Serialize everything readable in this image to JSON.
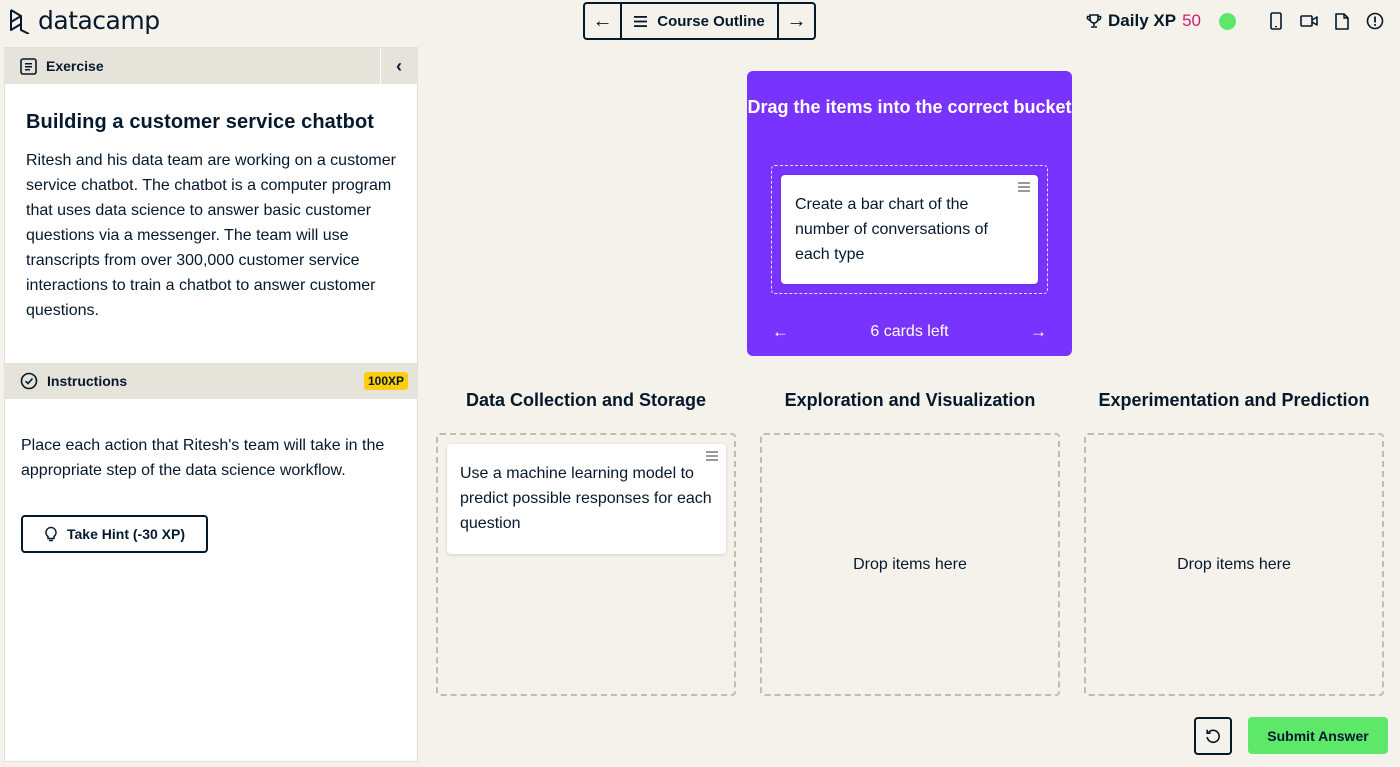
{
  "header": {
    "brand": "datacamp",
    "nav": {
      "prev_icon": "arrow-left-icon",
      "outline_label": "Course Outline",
      "next_icon": "arrow-right-icon"
    },
    "daily_xp_label": "Daily XP",
    "daily_xp_value": "50",
    "tools": [
      "mobile-icon",
      "video-icon",
      "slides-icon",
      "alert-icon"
    ]
  },
  "exercise": {
    "section_label": "Exercise",
    "title": "Building a customer service chatbot",
    "description": "Ritesh and his data team are working on a customer service chatbot. The chatbot is a computer program that uses data science to answer basic customer questions via a messenger. The team will use transcripts from over 300,000 customer service interactions to train a chatbot to answer customer questions."
  },
  "instructions": {
    "section_label": "Instructions",
    "xp_badge": "100XP",
    "text": "Place each action that Ritesh's team will take in the appropriate step of the data science workflow.",
    "hint_button": "Take Hint (-30 XP)"
  },
  "deck": {
    "title": "Drag the items into the correct bucket",
    "current_card": "Create a bar chart of the number of conversations of each type",
    "cards_left": "6 cards left"
  },
  "buckets": [
    {
      "title": "Data Collection and Storage",
      "cards": [
        "Use a machine learning model to predict possible responses for each question"
      ],
      "placeholder": ""
    },
    {
      "title": "Exploration and Visualization",
      "cards": [],
      "placeholder": "Drop items here"
    },
    {
      "title": "Experimentation and Prediction",
      "cards": [],
      "placeholder": "Drop items here"
    }
  ],
  "actions": {
    "submit_label": "Submit Answer",
    "reset_icon": "reset-icon"
  },
  "colors": {
    "background": "#f5f2eb",
    "accent_purple": "#7933ff",
    "submit_green": "#5ee86a",
    "xp_badge_yellow": "#fcce0d",
    "xp_value_pink": "#d21c6c",
    "text_navy": "#05192d"
  }
}
